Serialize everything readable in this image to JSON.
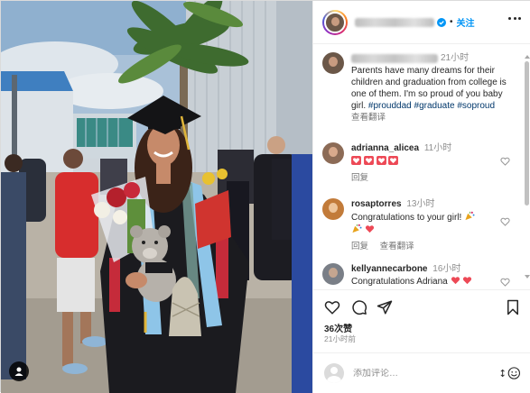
{
  "post": {
    "author_name_blurred": "",
    "follow_label": "关注",
    "more_icon": "more-horizontal-icon"
  },
  "caption": {
    "time": "21小时",
    "text": "Parents have many dreams for their children and graduation from college is one of them. I'm so proud of you baby girl.",
    "hashtags": [
      "#prouddad",
      "#graduate",
      "#soproud"
    ],
    "translate_label": "查看翻译"
  },
  "comments": [
    {
      "user": "adrianna_alicea",
      "time": "11小时",
      "text": "",
      "emoji": [
        "heart",
        "heart",
        "heart",
        "heart"
      ],
      "reply_label": "回复",
      "translate_label": ""
    },
    {
      "user": "rosaptorres",
      "time": "13小时",
      "text": "Congratulations to your girl!",
      "emoji": [
        "party-popper",
        "party-popper",
        "heart"
      ],
      "reply_label": "回复",
      "translate_label": "查看翻译"
    },
    {
      "user": "kellyannecarbone",
      "time": "16小时",
      "text": "Congratulations Adriana",
      "emoji": [
        "heart",
        "heart"
      ],
      "reply_label": "",
      "translate_label": ""
    }
  ],
  "actions": {
    "icons": [
      "heart-icon",
      "comment-icon",
      "share-icon",
      "bookmark-icon"
    ],
    "likes": "36次赞",
    "posted": "21小时前"
  },
  "composer": {
    "placeholder": "添加评论…"
  },
  "colors": {
    "accent": "#0095f6",
    "hashtag": "#00376b",
    "heart": "#ed4956",
    "muted": "#8e8e8e"
  }
}
